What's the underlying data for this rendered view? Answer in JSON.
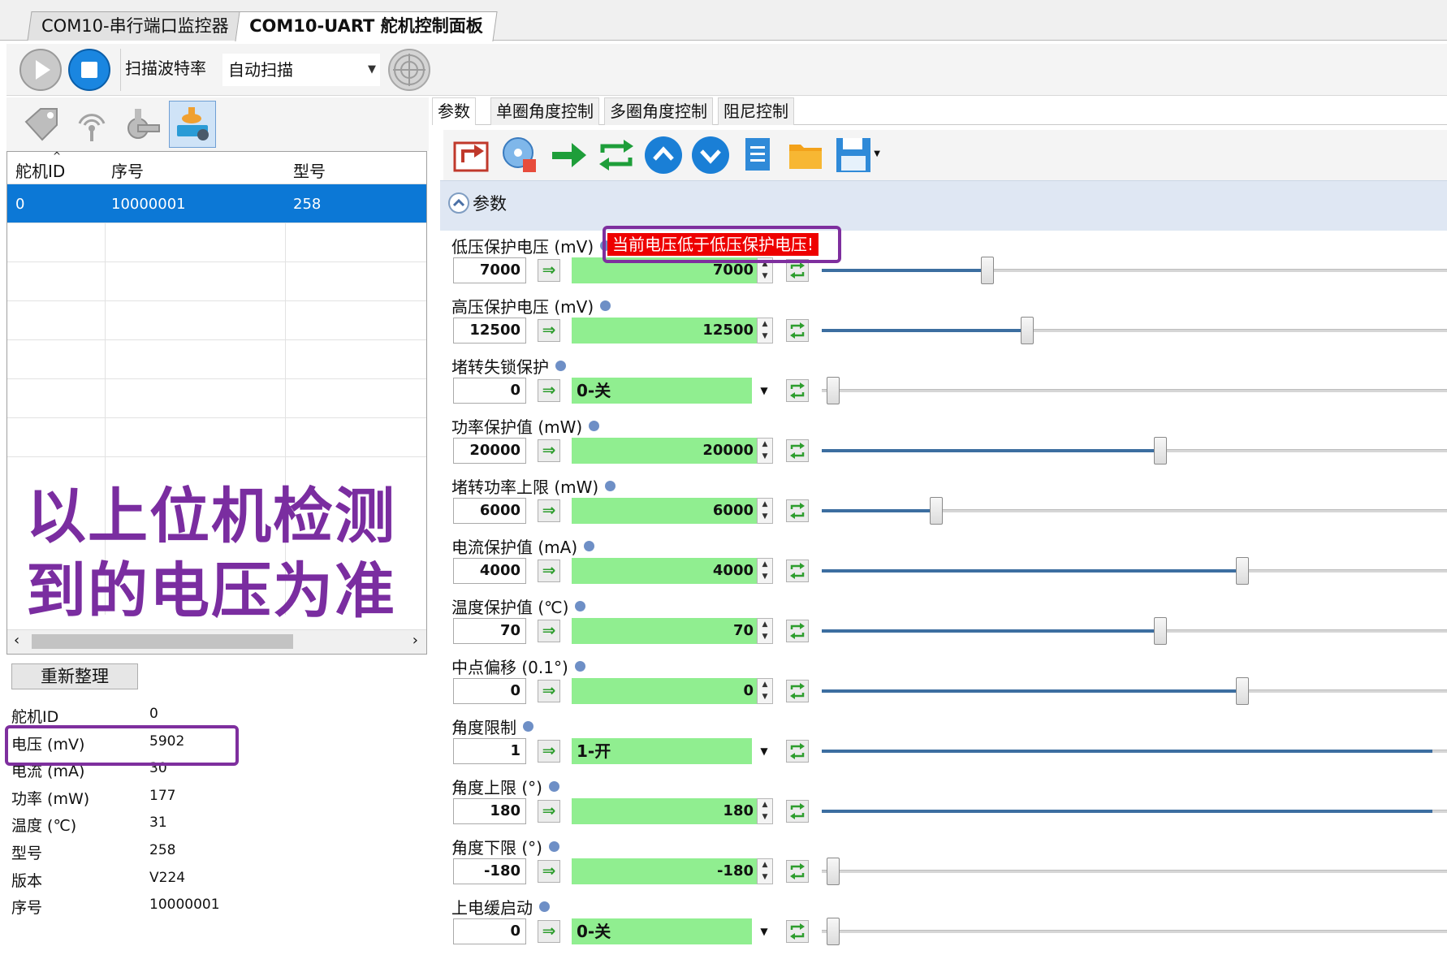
{
  "doc_tabs": [
    "COM10-串行端口监控器",
    "COM10-UART 舵机控制面板"
  ],
  "toolbar": {
    "scan_label": "扫描波特率",
    "scan_value": "自动扫描"
  },
  "grid": {
    "headers": [
      "舵机ID",
      "序号",
      "型号"
    ],
    "rows": [
      {
        "id": "0",
        "serial": "10000001",
        "model": "258"
      }
    ]
  },
  "overlay": {
    "line1": "以上位机检测",
    "line2": "到的电压为准"
  },
  "reorg_label": "重新整理",
  "info": [
    {
      "key": "舵机ID",
      "value": "0"
    },
    {
      "key": "电压 (mV)",
      "value": "5902"
    },
    {
      "key": "电流 (mA)",
      "value": "30"
    },
    {
      "key": "功率 (mW)",
      "value": "177"
    },
    {
      "key": "温度 (℃)",
      "value": "31"
    },
    {
      "key": "型号",
      "value": "258"
    },
    {
      "key": "版本",
      "value": "V224"
    },
    {
      "key": "序号",
      "value": "10000001"
    }
  ],
  "right_tabs": [
    "参数",
    "单圈角度控制",
    "多圈角度控制",
    "阻尼控制"
  ],
  "section_title": "参数",
  "warning": "当前电压低于低压保护电压!",
  "params": [
    {
      "label": "低压保护电压 (mV)",
      "input": "7000",
      "value": "7000",
      "kind": "num",
      "slider": 0.255
    },
    {
      "label": "高压保护电压 (mV)",
      "input": "12500",
      "value": "12500",
      "kind": "num",
      "slider": 0.32
    },
    {
      "label": "堵转失锁保护",
      "input": "0",
      "value": "0-关",
      "kind": "select",
      "slider": 0.0
    },
    {
      "label": "功率保护值 (mW)",
      "input": "20000",
      "value": "20000",
      "kind": "num",
      "slider": 0.54
    },
    {
      "label": "堵转功率上限 (mW)",
      "input": "6000",
      "value": "6000",
      "kind": "num",
      "slider": 0.17
    },
    {
      "label": "电流保护值 (mA)",
      "input": "4000",
      "value": "4000",
      "kind": "num",
      "slider": 0.675
    },
    {
      "label": "温度保护值 (℃)",
      "input": "70",
      "value": "70",
      "kind": "num",
      "slider": 0.54
    },
    {
      "label": "中点偏移 (0.1°)",
      "input": "0",
      "value": "0",
      "kind": "num",
      "slider": 0.675
    },
    {
      "label": "角度限制",
      "input": "1",
      "value": "1-开",
      "kind": "select",
      "slider": 1.0
    },
    {
      "label": "角度上限 (°)",
      "input": "180",
      "value": "180",
      "kind": "num",
      "slider": 1.0
    },
    {
      "label": "角度下限 (°)",
      "input": "-180",
      "value": "-180",
      "kind": "num",
      "slider": 0.0
    },
    {
      "label": "上电缓启动",
      "input": "0",
      "value": "0-关",
      "kind": "select",
      "slider": 0.0
    }
  ],
  "colors": {
    "accent": "#0c78d6",
    "green": "#90ee90",
    "highlight": "#7e2f9e",
    "warning": "#ee0000"
  }
}
